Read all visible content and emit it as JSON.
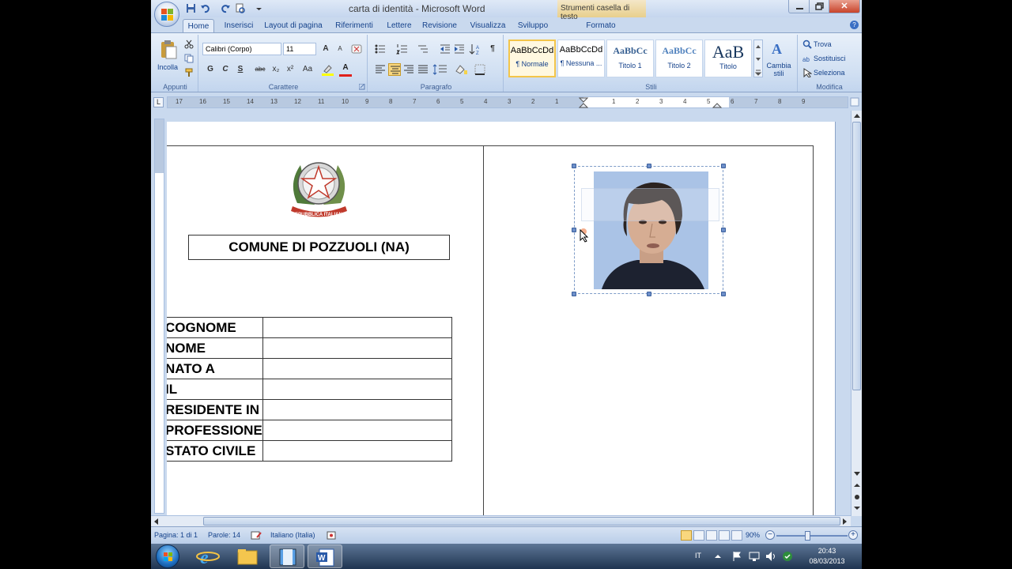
{
  "title_bar": {
    "document_title": "carta di identità - Microsoft Word",
    "contextual_tab_group": "Strumenti casella di testo",
    "close_symbol": "✕"
  },
  "tabs": [
    "Home",
    "Inserisci",
    "Layout di pagina",
    "Riferimenti",
    "Lettere",
    "Revisione",
    "Visualizza",
    "Sviluppo",
    "Formato"
  ],
  "active_tab": "Home",
  "help_symbol": "?",
  "ribbon": {
    "clipboard": {
      "paste_label": "Incolla",
      "group_label": "Appunti"
    },
    "font": {
      "font_name": "Calibri (Corpo)",
      "font_size": "11",
      "bold": "G",
      "italic": "C",
      "underline": "S",
      "strikethrough": "abc",
      "subscript": "x₂",
      "superscript": "x²",
      "change_case": "Aa",
      "grow_font": "A",
      "shrink_font": "A",
      "font_color_letter": "A",
      "group_label": "Carattere"
    },
    "paragraph": {
      "group_label": "Paragrafo",
      "pilcrow": "¶"
    },
    "styles": {
      "items": [
        {
          "sample": "AaBbCcDd",
          "name": "¶ Normale"
        },
        {
          "sample": "AaBbCcDd",
          "name": "¶ Nessuna ..."
        },
        {
          "sample": "AaBbCc",
          "name": "Titolo 1"
        },
        {
          "sample": "AaBbCc",
          "name": "Titolo 2"
        },
        {
          "sample": "AaB",
          "name": "Titolo"
        }
      ],
      "change_styles_line1": "Cambia",
      "change_styles_line2": "stili",
      "group_label": "Stili"
    },
    "editing": {
      "find": "Trova",
      "replace": "Sostituisci",
      "select": "Seleziona",
      "group_label": "Modifica"
    }
  },
  "ruler": {
    "corner": "L",
    "left_ticks": [
      "17",
      "16",
      "15",
      "14",
      "13",
      "12",
      "11",
      "10",
      "9",
      "8",
      "7",
      "6",
      "5",
      "4",
      "3",
      "2",
      "1"
    ],
    "right_ticks": [
      "1",
      "2",
      "3",
      "4",
      "5",
      "6",
      "7",
      "8",
      "9"
    ]
  },
  "document": {
    "comune": "COMUNE DI POZZUOLI (NA)",
    "emblem_text": "REPUBBLICA ITALIANA",
    "fields": [
      "COGNOME",
      "NOME",
      "NATO A",
      "IL",
      "RESIDENTE IN",
      "PROFESSIONE",
      "STATO CIVILE"
    ]
  },
  "status_bar": {
    "page": "Pagina: 1 di 1",
    "words": "Parole: 14",
    "language": "Italiano (Italia)",
    "zoom": "90%",
    "zoom_out": "−",
    "zoom_in": "+"
  },
  "taskbar": {
    "language": "IT",
    "time": "20:43",
    "date": "08/03/2013"
  },
  "colors": {
    "ribbon_blue": "#c9d9ee",
    "text_blue": "#15428b",
    "selected_style": "#f3c54a"
  }
}
